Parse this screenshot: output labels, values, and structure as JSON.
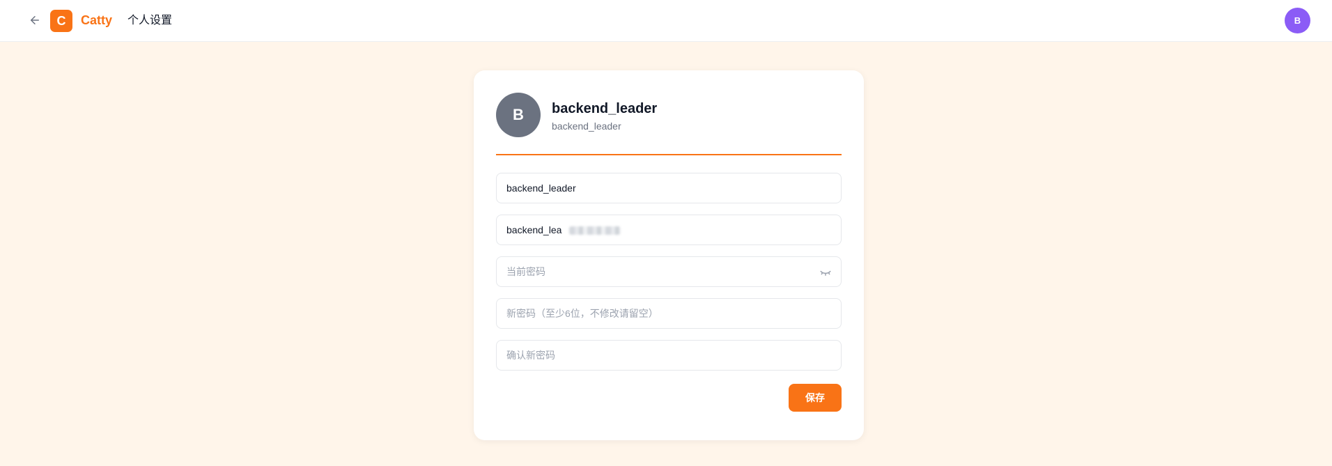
{
  "header": {
    "back_icon": "arrow-left-icon",
    "logo_letter": "C",
    "brand": "Catty",
    "page_title": "个人设置",
    "avatar_letter": "B"
  },
  "profile": {
    "avatar_letter": "B",
    "display_name": "backend_leader",
    "username": "backend_leader"
  },
  "form": {
    "display_name_value": "backend_leader",
    "email_value": "backend_lea",
    "current_password_placeholder": "当前密码",
    "current_password_toggle_icon": "eye-closed-icon",
    "new_password_placeholder": "新密码（至少6位，不修改请留空）",
    "confirm_password_placeholder": "确认新密码",
    "save_label": "保存"
  },
  "colors": {
    "accent": "#f97316",
    "page_background": "#fff5ea",
    "header_avatar": "#8b5cf6",
    "profile_avatar": "#6b7280"
  }
}
